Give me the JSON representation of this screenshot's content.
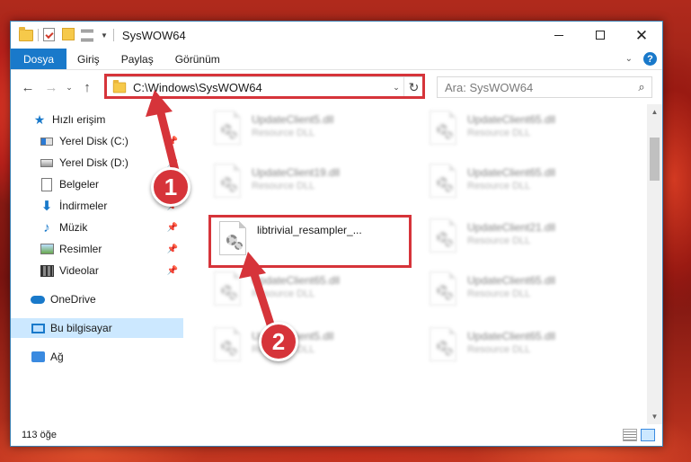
{
  "window": {
    "title": "SysWOW64",
    "buttons": {
      "minimize": "—",
      "maximize": "☐",
      "close": "✕"
    }
  },
  "ribbon": {
    "tabs": [
      "Dosya",
      "Giriş",
      "Paylaş",
      "Görünüm"
    ],
    "help": "?"
  },
  "address_bar": {
    "path": "C:\\Windows\\SysWOW64",
    "search_placeholder": "Ara: SysWOW64"
  },
  "sidebar": {
    "items": [
      {
        "label": "Hızlı erişim",
        "icon": "star-icon"
      },
      {
        "label": "Yerel Disk (C:)",
        "icon": "drive-icon",
        "pinned": true
      },
      {
        "label": "Yerel Disk (D:)",
        "icon": "drive-icon",
        "pinned": true
      },
      {
        "label": "Belgeler",
        "icon": "documents-icon",
        "pinned": true
      },
      {
        "label": "İndirmeler",
        "icon": "downloads-icon",
        "pinned": true
      },
      {
        "label": "Müzik",
        "icon": "music-icon",
        "pinned": true
      },
      {
        "label": "Resimler",
        "icon": "pictures-icon",
        "pinned": true
      },
      {
        "label": "Videolar",
        "icon": "videos-icon",
        "pinned": true
      },
      {
        "label": "OneDrive",
        "icon": "cloud-icon"
      },
      {
        "label": "Bu bilgisayar",
        "icon": "computer-icon",
        "selected": true
      },
      {
        "label": "Ağ",
        "icon": "network-icon"
      }
    ]
  },
  "files": [
    {
      "name": "UpdateClient5.dll",
      "type": "Resource DLL",
      "blurred": true
    },
    {
      "name": "UpdateClient65.dll",
      "type": "Resource DLL",
      "blurred": true
    },
    {
      "name": "UpdateClient19.dll",
      "type": "Resource DLL",
      "blurred": true
    },
    {
      "name": "UpdateClient65.dll",
      "type": "Resource DLL",
      "blurred": true
    },
    {
      "name": "libtrivial_resampler_...",
      "type": "",
      "blurred": false
    },
    {
      "name": "UpdateClient21.dll",
      "type": "Resource DLL",
      "blurred": true
    },
    {
      "name": "UpdateClient65.dll",
      "type": "Resource DLL",
      "blurred": true
    },
    {
      "name": "UpdateClient65.dll",
      "type": "Resource DLL",
      "blurred": true
    },
    {
      "name": "UpdateClient5.dll",
      "type": "Resource DLL",
      "blurred": true
    },
    {
      "name": "UpdateClient65.dll",
      "type": "Resource DLL",
      "blurred": true
    }
  ],
  "status": {
    "count": "113 öğe"
  },
  "callouts": [
    "1",
    "2"
  ],
  "colors": {
    "accent": "#1979ca",
    "highlight": "#d6343a",
    "selected": "#cce8ff"
  }
}
